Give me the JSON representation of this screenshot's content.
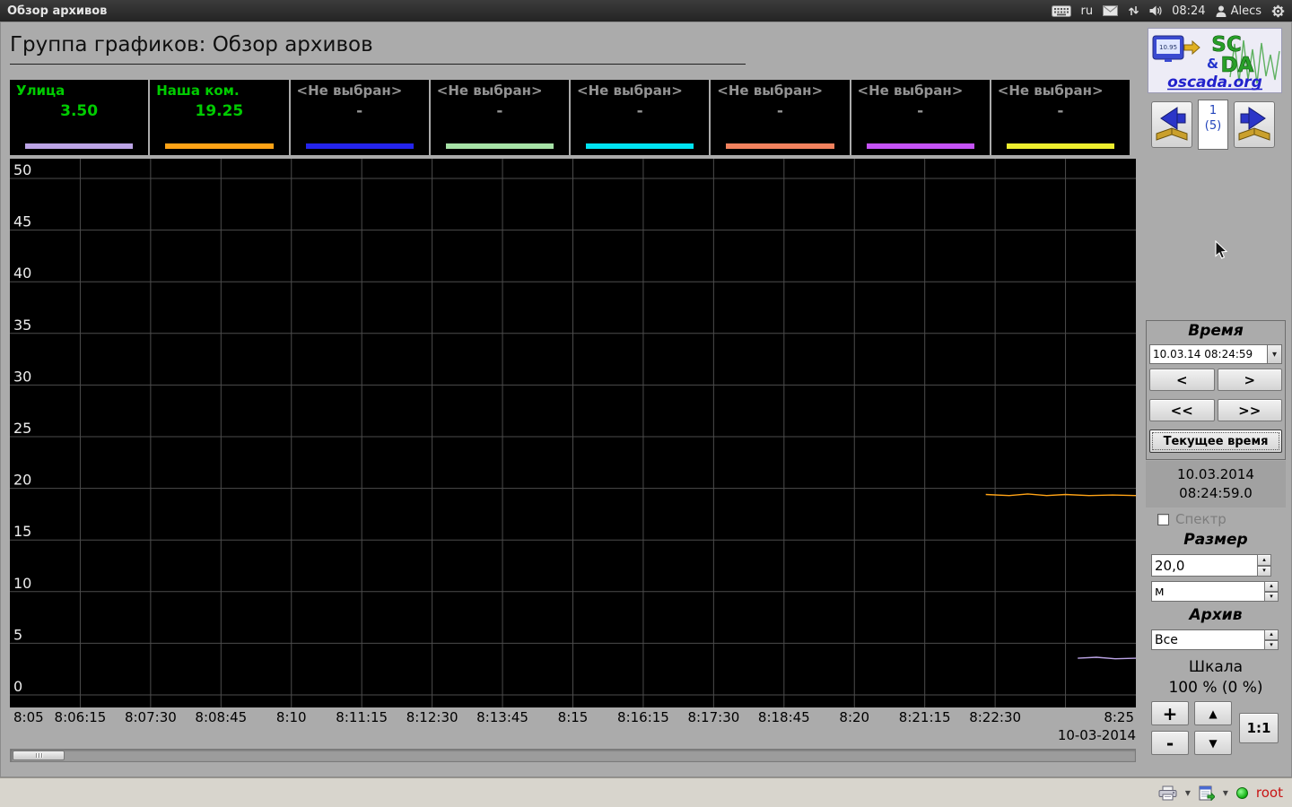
{
  "topbar": {
    "title": "Обзор архивов",
    "lang_indicator": "ru",
    "clock": "08:24",
    "user": "Alecs"
  },
  "page": {
    "title": "Группа графиков: Обзор архивов"
  },
  "colors": {
    "legend_active_text": "#00cc00",
    "legend_inactive_text": "#949494",
    "chart_bg": "#000000",
    "main_bg": "#ababab"
  },
  "legend": [
    {
      "name": "Улица",
      "value": "3.50",
      "bar_color": "#bca4e6",
      "selected": true
    },
    {
      "name": "Наша ком.",
      "value": "19.25",
      "bar_color": "#ffa316",
      "selected": true
    },
    {
      "name": "<Не выбран>",
      "value": "-",
      "bar_color": "#2424ec",
      "selected": false
    },
    {
      "name": "<Не выбран>",
      "value": "-",
      "bar_color": "#a6e2a6",
      "selected": false
    },
    {
      "name": "<Не выбран>",
      "value": "-",
      "bar_color": "#00e4f2",
      "selected": false
    },
    {
      "name": "<Не выбран>",
      "value": "-",
      "bar_color": "#f2825e",
      "selected": false
    },
    {
      "name": "<Не выбран>",
      "value": "-",
      "bar_color": "#c653f6",
      "selected": false
    },
    {
      "name": "<Не выбран>",
      "value": "-",
      "bar_color": "#eeee2e",
      "selected": false
    }
  ],
  "chart_data": {
    "type": "line",
    "ylim": [
      0,
      50
    ],
    "y_ticks": [
      0,
      5,
      10,
      15,
      20,
      25,
      30,
      35,
      40,
      45,
      50
    ],
    "x_gridlines": 16,
    "x_range_seconds": 1200,
    "x_tick_labels": [
      "8:05",
      "8:06:15",
      "8:07:30",
      "8:08:45",
      "8:10",
      "8:11:15",
      "8:12:30",
      "8:13:45",
      "8:15",
      "8:16:15",
      "8:17:30",
      "8:18:45",
      "8:20",
      "8:21:15",
      "8:22:30",
      "8:25"
    ],
    "date_label": "10-03-2014",
    "grid_color": "#4c4c4c",
    "grid": true,
    "series": [
      {
        "name": "Наша ком.",
        "color": "#ffa316",
        "points": [
          [
            1040,
            19.4
          ],
          [
            1065,
            19.3
          ],
          [
            1085,
            19.45
          ],
          [
            1105,
            19.3
          ],
          [
            1125,
            19.4
          ],
          [
            1150,
            19.3
          ],
          [
            1175,
            19.35
          ],
          [
            1200,
            19.3
          ]
        ]
      },
      {
        "name": "Улица",
        "color": "#bca4e6",
        "points": [
          [
            1138,
            3.55
          ],
          [
            1158,
            3.65
          ],
          [
            1178,
            3.5
          ],
          [
            1200,
            3.55
          ]
        ]
      }
    ]
  },
  "sidebar": {
    "logo": {
      "sc": "SC",
      "amp": "&",
      "da": "DA",
      "site": "oscada.org",
      "version": "10.95"
    },
    "pager": {
      "page": "1",
      "of": "(5)"
    },
    "time_panel": {
      "label": "Время",
      "combo_value": "10.03.14 08:24:59",
      "step_back": "<",
      "step_fwd": ">",
      "jump_back": "<<",
      "jump_fwd": ">>",
      "current_time_btn": "Текущее время",
      "display_date": "10.03.2014",
      "display_time": "08:24:59.0"
    },
    "spectrum": {
      "label": "Спектр",
      "checked": false
    },
    "size_panel": {
      "label": "Размер",
      "value": "20,0",
      "unit": "м"
    },
    "archive_panel": {
      "label": "Архив",
      "value": "Все"
    },
    "scale_panel": {
      "label": "Шкала",
      "value": "100 % (0 %)",
      "zoom_in": "+",
      "zoom_out": "-",
      "one_to_one": "1:1"
    }
  },
  "bottombar": {
    "user": "root"
  },
  "icons": {
    "caret_down": "▾",
    "spin_up": "▴",
    "spin_down": "▾",
    "pan_up": "▲",
    "pan_down": "▼"
  }
}
